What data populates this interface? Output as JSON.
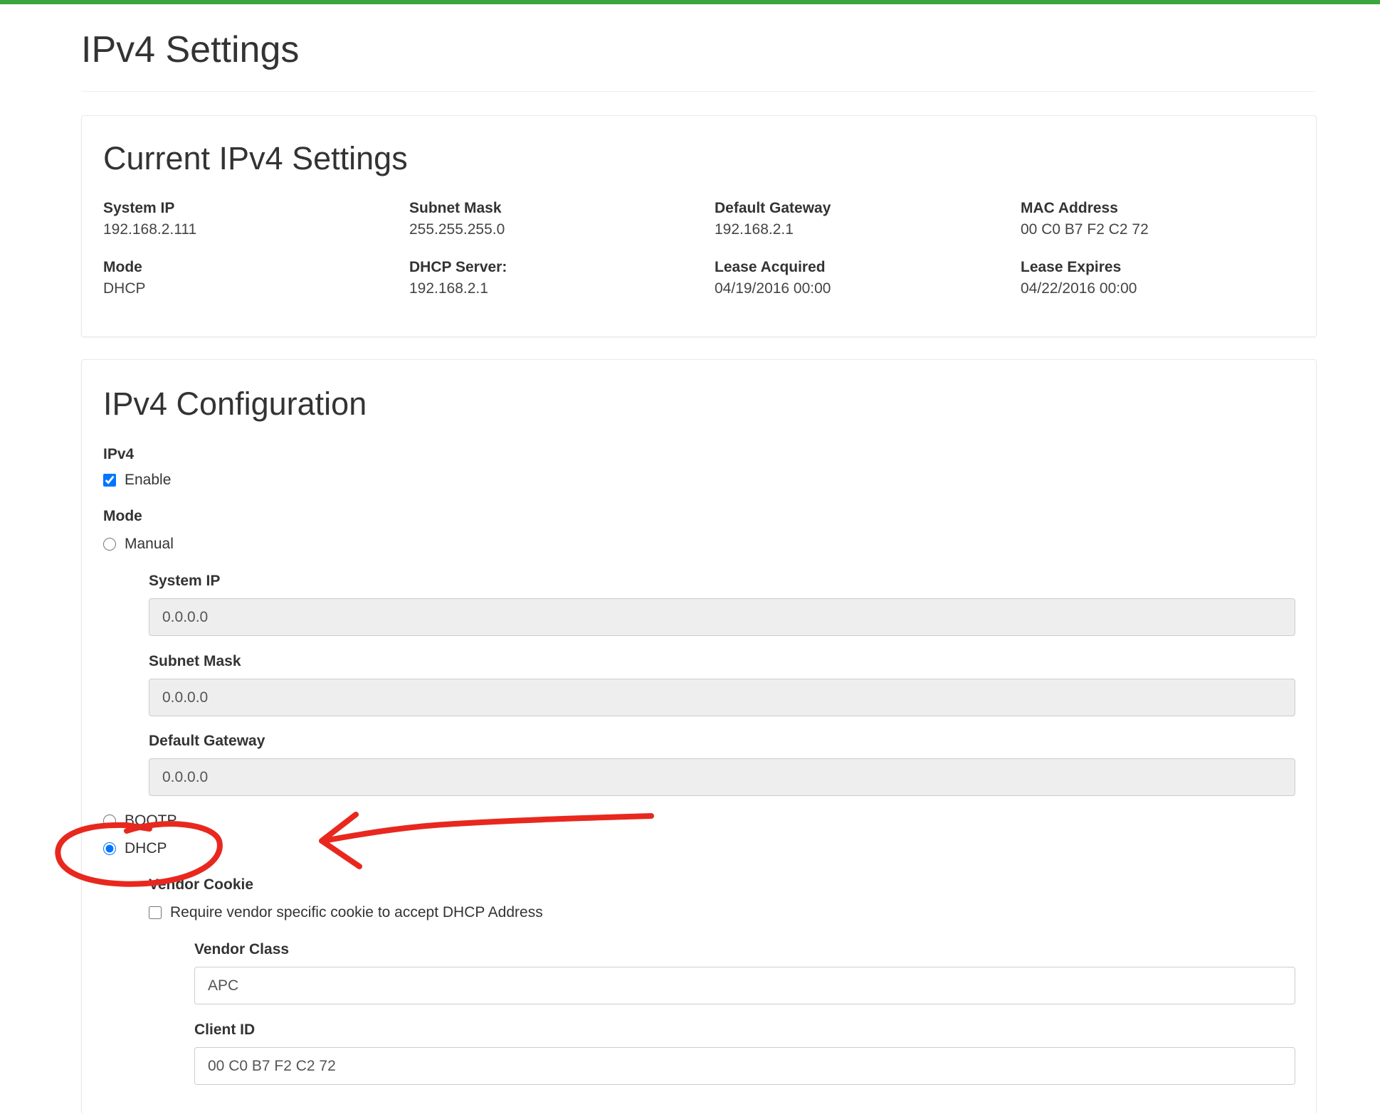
{
  "header": {
    "title": "IPv4 Settings",
    "accent_color": "#3ba53f"
  },
  "current": {
    "title": "Current IPv4 Settings",
    "system_ip": {
      "label": "System IP",
      "value": "192.168.2.111"
    },
    "subnet_mask": {
      "label": "Subnet Mask",
      "value": "255.255.255.0"
    },
    "default_gateway": {
      "label": "Default Gateway",
      "value": "192.168.2.1"
    },
    "mac_address": {
      "label": "MAC Address",
      "value": "00 C0 B7 F2 C2 72"
    },
    "mode": {
      "label": "Mode",
      "value": "DHCP"
    },
    "dhcp_server": {
      "label": "DHCP Server:",
      "value": "192.168.2.1"
    },
    "lease_acquired": {
      "label": "Lease Acquired",
      "value": "04/19/2016 00:00"
    },
    "lease_expires": {
      "label": "Lease Expires",
      "value": "04/22/2016 00:00"
    }
  },
  "config": {
    "title": "IPv4 Configuration",
    "ipv4_label": "IPv4",
    "enable_label": "Enable",
    "enable_checked": true,
    "mode_label": "Mode",
    "manual_label": "Manual",
    "system_ip_label": "System IP",
    "system_ip_value": "0.0.0.0",
    "subnet_mask_label": "Subnet Mask",
    "subnet_mask_value": "0.0.0.0",
    "default_gateway_label": "Default Gateway",
    "default_gateway_value": "0.0.0.0",
    "bootp_label": "BOOTP",
    "dhcp_label": "DHCP",
    "selected_mode": "DHCP",
    "vendor_cookie_label": "Vendor Cookie",
    "vendor_cookie_checkbox_label": "Require vendor specific cookie to accept DHCP Address",
    "vendor_cookie_checked": false,
    "vendor_class_label": "Vendor Class",
    "vendor_class_value": "APC",
    "client_id_label": "Client ID",
    "client_id_value": "00 C0 B7 F2 C2 72"
  },
  "annotation": {
    "color": "#e8281e",
    "shapes": [
      "circle",
      "arrow"
    ]
  }
}
